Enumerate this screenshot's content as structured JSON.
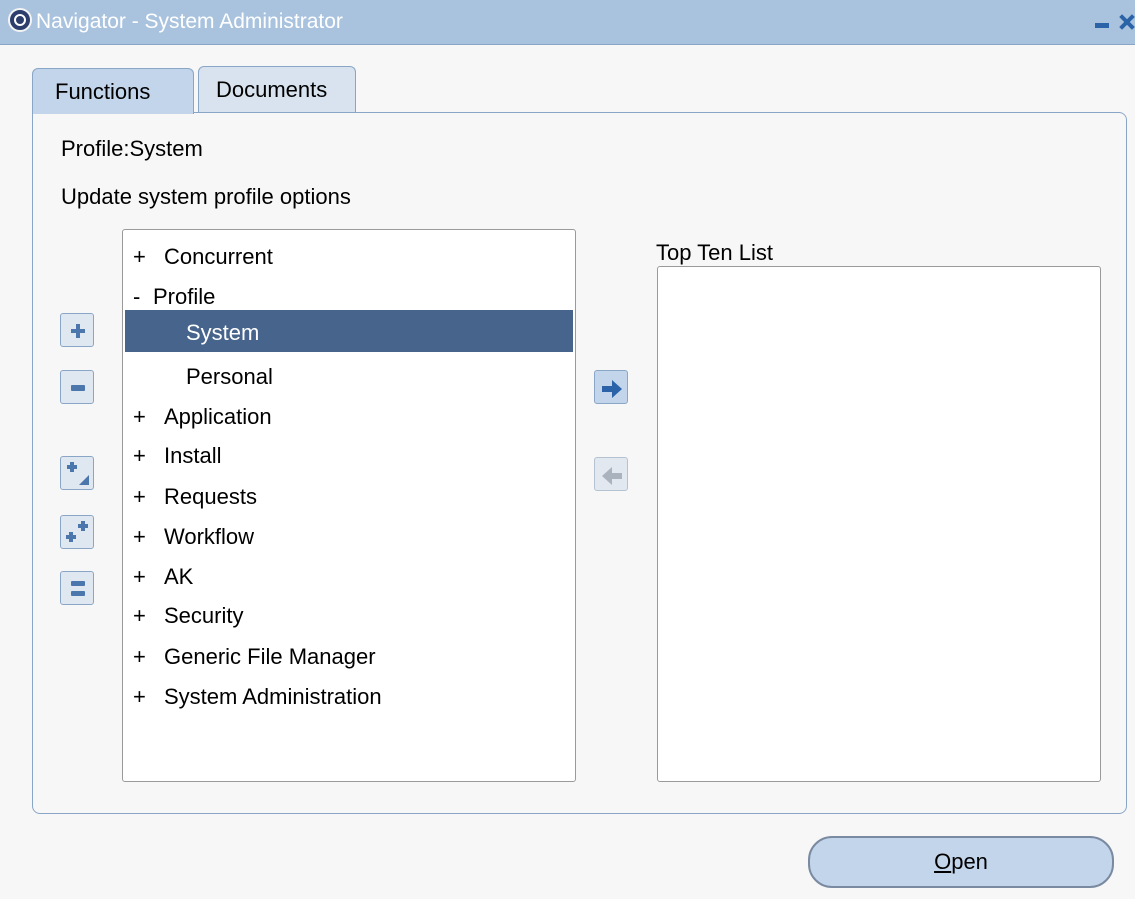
{
  "window": {
    "title": "Navigator - System Administrator",
    "icon": "oracle-logo-icon",
    "controls": [
      "minimize-icon",
      "close-icon"
    ]
  },
  "tabs": [
    {
      "label": "Functions",
      "active": true
    },
    {
      "label": "Documents",
      "active": false
    }
  ],
  "main": {
    "selected_path": "Profile:System",
    "description": "Update system profile options",
    "top_ten_label": "Top Ten List",
    "top_ten_items": []
  },
  "tree": {
    "items": [
      {
        "sign": "+",
        "label": "Concurrent",
        "level": 0
      },
      {
        "sign": "-",
        "label": "Profile",
        "level": 0
      },
      {
        "sign": "",
        "label": "System",
        "level": 1,
        "selected": true
      },
      {
        "sign": "",
        "label": "Personal",
        "level": 1
      },
      {
        "sign": "+",
        "label": "Application",
        "level": 0
      },
      {
        "sign": "+",
        "label": "Install",
        "level": 0
      },
      {
        "sign": "+",
        "label": "Requests",
        "level": 0
      },
      {
        "sign": "+",
        "label": "Workflow",
        "level": 0
      },
      {
        "sign": "+",
        "label": "AK",
        "level": 0
      },
      {
        "sign": "+",
        "label": "Security",
        "level": 0
      },
      {
        "sign": "+",
        "label": "Generic File Manager",
        "level": 0
      },
      {
        "sign": "+",
        "label": "System Administration",
        "level": 0
      }
    ]
  },
  "tree_buttons": [
    "expand-icon",
    "collapse-icon",
    "expand-branch-icon",
    "expand-all-icon",
    "collapse-all-icon"
  ],
  "transfer_buttons": [
    "add-to-list-icon",
    "remove-from-list-icon"
  ],
  "footer": {
    "open_label": "Open",
    "open_mnemonic": "O"
  },
  "colors": {
    "titlebar": "#a9c3df",
    "selection": "#47648c",
    "button_face": "#c3d5ea",
    "icon_blue": "#2b63a8"
  }
}
